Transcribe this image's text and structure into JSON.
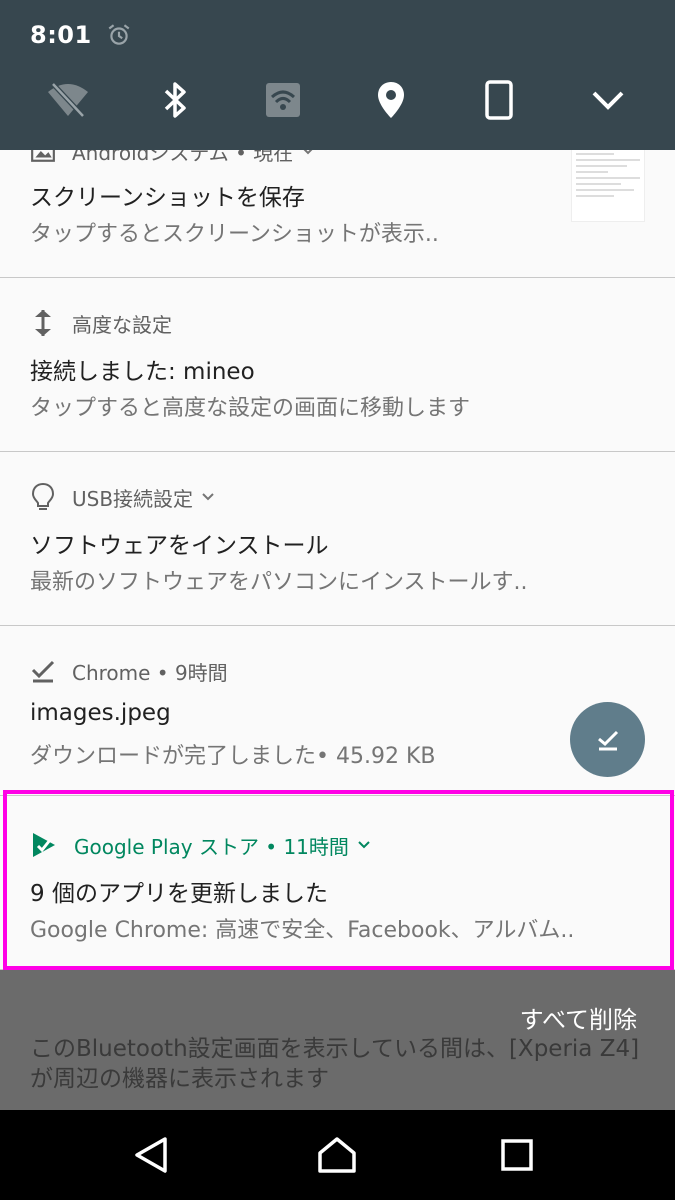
{
  "status_bar": {
    "time": "8:01",
    "alarm_icon": "alarm-icon"
  },
  "quick_settings": [
    {
      "icon": "wifi-off-icon"
    },
    {
      "icon": "bluetooth-icon"
    },
    {
      "icon": "hotspot-icon"
    },
    {
      "icon": "location-icon"
    },
    {
      "icon": "phone-rotation-icon"
    },
    {
      "icon": "expand-chevron-icon"
    }
  ],
  "notifications": [
    {
      "app": "Androidシステム • 現在",
      "icon": "image-icon",
      "title": "スクリーンショットを保存",
      "text": "タップするとスクリーンショットが表示.."
    },
    {
      "app": "高度な設定",
      "icon": "vertical-arrows-icon",
      "title": "接続しました: mineo",
      "text": "タップすると高度な設定の画面に移動します"
    },
    {
      "app": "USB接続設定",
      "icon": "lightbulb-icon",
      "title": "ソフトウェアをインストール",
      "text": "最新のソフトウェアをパソコンにインストールす.."
    },
    {
      "app": "Chrome • 9時間",
      "icon": "download-done-icon",
      "title": "images.jpeg",
      "text": "ダウンロードが完了しました• 45.92 KB"
    },
    {
      "app": "Google Play ストア • 11時間",
      "icon": "google-play-icon",
      "title": "9 個のアプリを更新しました",
      "text": "Google Chrome: 高速で安全、Facebook、アルバム.."
    }
  ],
  "clear_all": "すべて削除",
  "bluetooth_message": "このBluetooth設定画面を表示している間は、[Xperia Z4]が周辺の機器に表示されます",
  "colors": {
    "shade": "#37474f",
    "play_green": "#01875f",
    "highlight": "#ff00e6",
    "fab": "#607d8b"
  }
}
